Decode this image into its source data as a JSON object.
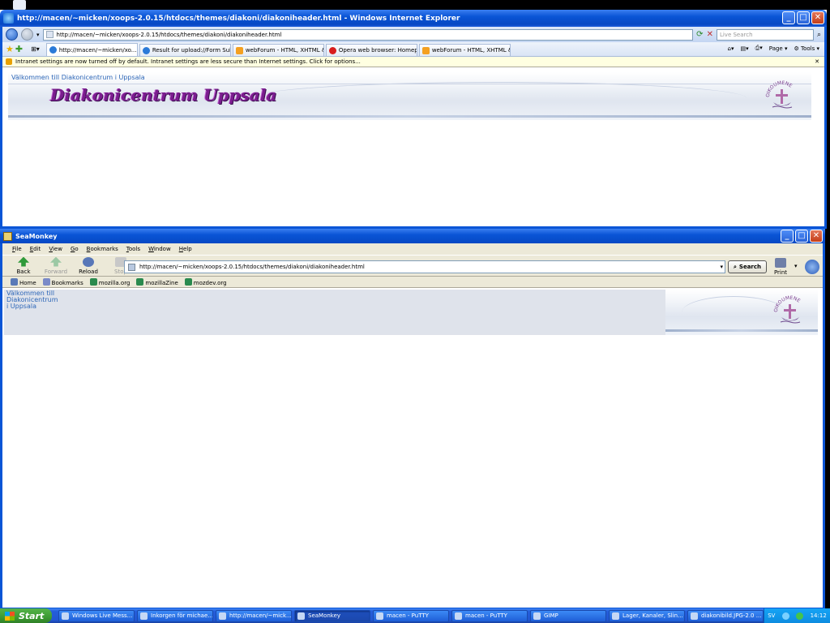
{
  "ie": {
    "title": "http://macen/~micken/xoops-2.0.15/htdocs/themes/diakoni/diakoniheader.html - Windows Internet Explorer",
    "address": "http://macen/~micken/xoops-2.0.15/htdocs/themes/diakoni/diakoniheader.html",
    "search_placeholder": "Live Search",
    "tabs": [
      {
        "label": "http://macen/~micken/xo...",
        "icon": "ie-page-icon"
      },
      {
        "label": "Result for upload://Form Sub...",
        "icon": "ie-page-icon"
      },
      {
        "label": "webForum - HTML, XHTML & ...",
        "icon": "forum-icon"
      },
      {
        "label": "Opera web browser: Homep...",
        "icon": "opera-icon"
      },
      {
        "label": "webForum - HTML, XHTML & ...",
        "icon": "forum-icon"
      }
    ],
    "toolbar_right": {
      "page": "Page",
      "tools": "Tools"
    },
    "infobar": "Intranet settings are now turned off by default. Intranet settings are less secure than Internet settings. Click for options...",
    "page": {
      "welcome": "Välkommen till Diakonicentrum i Uppsala",
      "site_title": "Diakonicentrum Uppsala",
      "logo_text": "OIKOUMENE"
    }
  },
  "seamonkey": {
    "title": "SeaMonkey",
    "menu": [
      "File",
      "Edit",
      "View",
      "Go",
      "Bookmarks",
      "Tools",
      "Window",
      "Help"
    ],
    "nav": {
      "back": "Back",
      "forward": "Forward",
      "reload": "Reload",
      "stop": "Stop",
      "print": "Print"
    },
    "address": "http://macen/~micken/xoops-2.0.15/htdocs/themes/diakoni/diakoniheader.html",
    "search_button": "Search",
    "bookmarks": [
      "Home",
      "Bookmarks",
      "mozilla.org",
      "mozillaZine",
      "mozdev.org"
    ],
    "page": {
      "welcome_lines": [
        "Välkommen till",
        "Diakonicentrum",
        "i Uppsala"
      ],
      "logo_text": "OIKOUMENE"
    }
  },
  "taskbar": {
    "start": "Start",
    "tasks": [
      "Windows Live Mess...",
      "Inkorgen för michae...",
      "http://macen/~mick...",
      "SeaMonkey",
      "macen - PuTTY",
      "macen - PuTTY",
      "GIMP",
      "Lager, Kanaler, Slin...",
      "diakonibild.JPG-2.0 ..."
    ],
    "active_task_index": 3,
    "lang": "SV",
    "clock": "14:12"
  },
  "colors": {
    "xp_blue": "#0a55d6",
    "title_purple": "#7b1d8f",
    "welcome_blue": "#2e67b8"
  }
}
